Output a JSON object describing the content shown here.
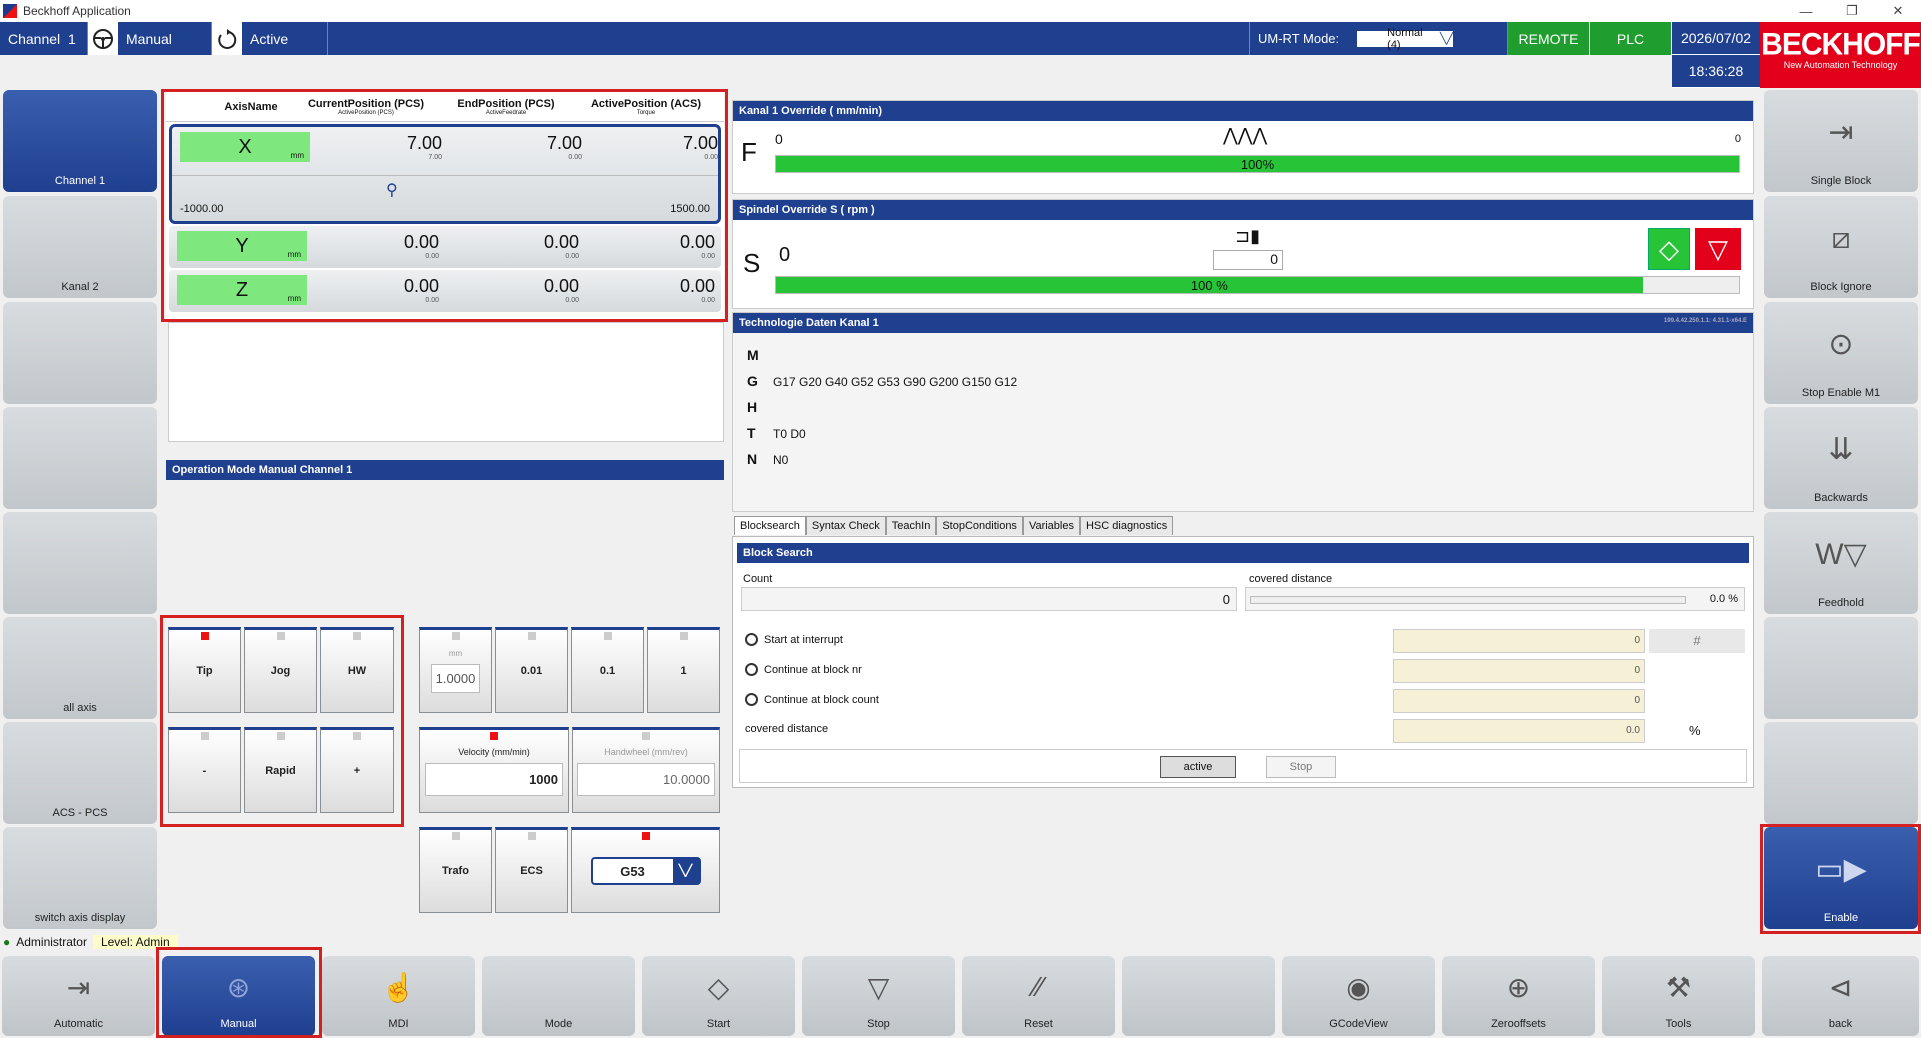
{
  "app": {
    "title": "Beckhoff Application",
    "min": "—",
    "max": "❐",
    "close": "✕"
  },
  "topbar": {
    "channel_label": "Channel",
    "channel_no": "1",
    "mode": "Manual",
    "state": "Active",
    "umrt_label": "UM-RT Mode:",
    "umrt_value": "Normal (4)",
    "remote": "REMOTE",
    "plc": "PLC",
    "date": "2026/07/02",
    "time": "18:36:28"
  },
  "logo": {
    "name": "BECKHOFF",
    "tagline": "New Automation Technology"
  },
  "left_buttons": [
    "Channel 1",
    "Kanal 2",
    "",
    "",
    "",
    "all axis",
    "ACS - PCS",
    "switch axis display"
  ],
  "right_buttons": [
    "Single Block",
    "Block Ignore",
    "Stop Enable M1",
    "Backwards",
    "Feedhold",
    "",
    "",
    "Enable"
  ],
  "axis": {
    "headers": [
      {
        "t": "AxisName",
        "s": ""
      },
      {
        "t": "CurrentPosition (PCS)",
        "s": "ActivePosition (PCS)"
      },
      {
        "t": "EndPosition (PCS)",
        "s": "ActiveFeedrate"
      },
      {
        "t": "ActivePosition (ACS)",
        "s": "Torque"
      }
    ],
    "rows": [
      {
        "name": "X",
        "unit": "mm",
        "v1": "7.00",
        "s1": "7.00",
        "v2": "7.00",
        "s2": "0.00",
        "v3": "7.00",
        "s3": "0.00",
        "min": "-1000.00",
        "max": "1500.00"
      },
      {
        "name": "Y",
        "unit": "mm",
        "v1": "0.00",
        "s1": "0.00",
        "v2": "0.00",
        "s2": "0.00",
        "v3": "0.00",
        "s3": "0.00"
      },
      {
        "name": "Z",
        "unit": "mm",
        "v1": "0.00",
        "s1": "0.00",
        "v2": "0.00",
        "s2": "0.00",
        "v3": "0.00",
        "s3": "0.00"
      }
    ]
  },
  "override": {
    "title": "Kanal 1 Override  ( mm/min)",
    "letter": "F",
    "value": "0",
    "right": "0",
    "percent": "100%",
    "level": 1.0
  },
  "spindle": {
    "title": "Spindel Override S ( rpm    )",
    "letter": "S",
    "value": "0",
    "field": "0",
    "percent": "100 %",
    "level": 0.9
  },
  "tech": {
    "title": "Technologie Daten Kanal 1",
    "version": "199.4.42.250.1.1: 4.31.1-x64.E",
    "rows": [
      {
        "k": "M",
        "v": ""
      },
      {
        "k": "G",
        "v": "G17 G20 G40 G52 G53 G90 G200 G150 G12"
      },
      {
        "k": "H",
        "v": ""
      },
      {
        "k": "T",
        "v": "T0   D0"
      },
      {
        "k": "N",
        "v": "N0"
      }
    ]
  },
  "opmode": {
    "title": "Operation Mode Manual Channel 1",
    "tip": "Tip",
    "jog": "Jog",
    "hw": "HW",
    "minus": "-",
    "rapid": "Rapid",
    "plus": "+",
    "mm": "mm",
    "step": "1.0000",
    "s1": "0.01",
    "s2": "0.1",
    "s3": "1",
    "vel_label": "Velocity (mm/min)",
    "vel": "1000",
    "hw_label": "Handwheel (mm/rev)",
    "hw_val": "10.0000",
    "trafo": "Trafo",
    "ecs": "ECS",
    "g53": "G53"
  },
  "tabs": [
    "Blocksearch",
    "Syntax Check",
    "TeachIn",
    "StopConditions",
    "Variables",
    "HSC diagnostics"
  ],
  "blocksearch": {
    "title": "Block Search",
    "count_label": "Count",
    "count": "0",
    "cov_label": "covered distance",
    "cov": "0.0 %",
    "opt1": "Start at interrupt",
    "opt2": "Continue at block nr",
    "opt3": "Continue at block count",
    "cov2": "covered distance",
    "f1": "0",
    "f2": "0",
    "f3": "0",
    "f4": "0.0",
    "hash": "#",
    "pct": "%",
    "active": "active",
    "stop": "Stop"
  },
  "user": {
    "name": "Administrator",
    "level": "Level: Admin"
  },
  "bottom": [
    "Automatic",
    "Manual",
    "MDI",
    "Mode",
    "Start",
    "Stop",
    "Reset",
    "",
    "GCodeView",
    "Zerooffsets",
    "Tools",
    "back"
  ]
}
